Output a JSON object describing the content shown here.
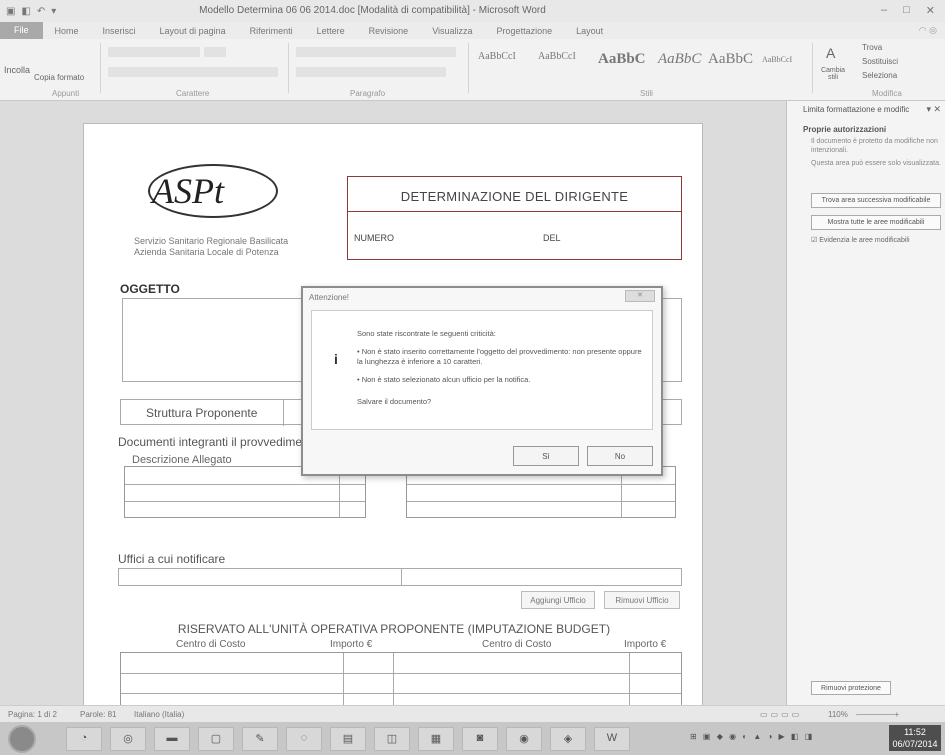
{
  "window": {
    "title": "Modello Determina 06 06 2014.doc [Modalità di compatibilità] - Microsoft Word"
  },
  "ribbon": {
    "file_tab": "File",
    "tabs": [
      "Home",
      "Inserisci",
      "Layout di pagina",
      "Riferimenti",
      "Lettere",
      "Revisione",
      "Visualizza",
      "Progettazione",
      "Layout"
    ],
    "groups": [
      "Appunti",
      "Carattere",
      "Paragrafo",
      "Stili",
      "Modifica"
    ],
    "paste_label": "Incolla",
    "copy_format_label": "Copia formato",
    "style_samples": [
      "AaBbCcI",
      "AaBbCcI",
      "AaBbC",
      "AaBbC",
      "AaBbC",
      "AaBbCcI"
    ],
    "change_styles_label": "Cambia stili",
    "find_label": "Trova",
    "replace_label": "Sostituisci",
    "select_label": "Seleziona"
  },
  "document": {
    "logo_text": "ASPt",
    "org_line1": "Servizio Sanitario Regionale Basilicata",
    "org_line2": "Azienda Sanitaria Locale di Potenza",
    "det_title": "DETERMINAZIONE DEL DIRIGENTE",
    "numero_label": "NUMERO",
    "del_label": "DEL",
    "oggetto_label": "OGGETTO",
    "struttura_label": "Struttura Proponente",
    "documenti_label": "Documenti integranti il provvedime",
    "descrizione_label": "Descrizione Allegato",
    "uffici_label": "Uffici a cui notificare",
    "aggiungi_btn": "Aggiungi Ufficio",
    "rimuovi_btn": "Rimuovi Ufficio",
    "budget_title": "RISERVATO ALL'UNITÀ OPERATIVA PROPONENTE (IMPUTAZIONE BUDGET)",
    "budget_headers": [
      "Centro di Costo",
      "Importo €",
      "Centro di Costo",
      "Importo €"
    ]
  },
  "pane": {
    "header": "Limita formattazione e modific",
    "section": "Proprie autorizzazioni",
    "text1": "Il documento è protetto da modifiche non intenzionali.",
    "text2": "Questa area può essere solo visualizzata.",
    "btn_next": "Trova area successiva modificabile",
    "btn_all": "Mostra tutte le aree modificabili",
    "check_label": "Evidenzia le aree modificabili",
    "stop_btn": "Rimuovi protezione"
  },
  "status": {
    "page": "Pagina: 1 di 2",
    "words": "Parole: 81",
    "language": "Italiano (Italia)",
    "zoom": "110%"
  },
  "taskbar": {
    "time": "11:52",
    "date": "06/07/2014"
  },
  "dialog": {
    "title": "Attenzione!",
    "line_intro": "Sono state riscontrate le seguenti criticità:",
    "bullet1": "• Non è stato inserito correttamente l'oggetto del provvedimento: non presente oppure la lunghezza è inferiore a 10 caratteri.",
    "bullet2": "• Non è stato selezionato alcun ufficio per la notifica.",
    "question": "Salvare il documento?",
    "yes_btn": "Sì",
    "no_btn": "No"
  }
}
